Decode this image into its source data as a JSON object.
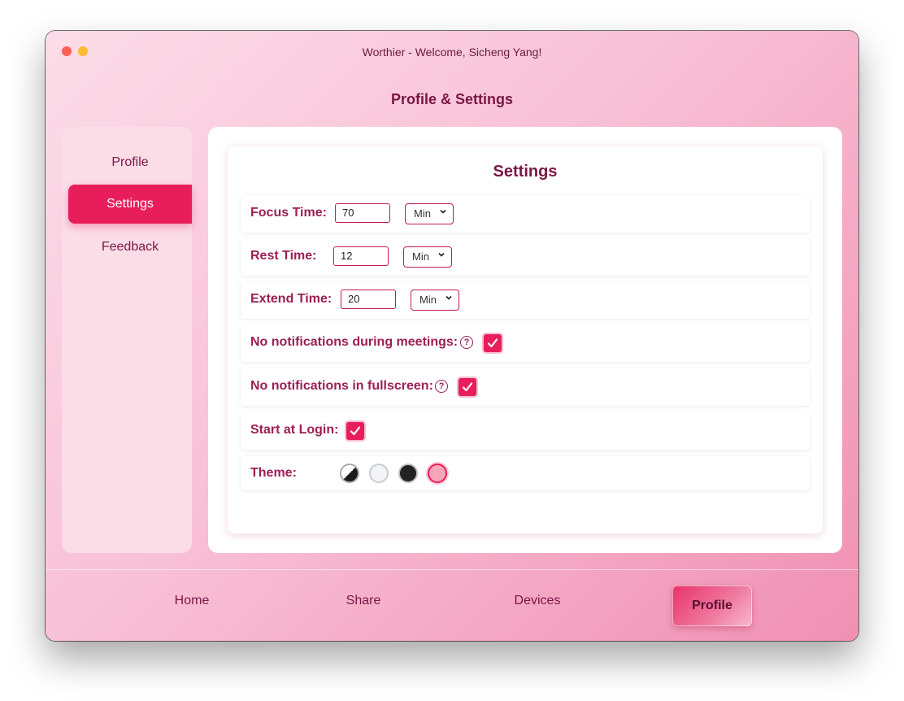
{
  "window": {
    "title": "Worthier - Welcome, Sicheng Yang!"
  },
  "page": {
    "title": "Profile & Settings"
  },
  "sidebar": {
    "items": [
      {
        "label": "Profile"
      },
      {
        "label": "Settings",
        "active": true
      },
      {
        "label": "Feedback"
      }
    ]
  },
  "settings": {
    "title": "Settings",
    "focus_time": {
      "label": "Focus Time:",
      "value": "70",
      "unit": "Min"
    },
    "rest_time": {
      "label": "Rest Time:",
      "value": "12",
      "unit": "Min"
    },
    "extend_time": {
      "label": "Extend Time:",
      "value": "20",
      "unit": "Min"
    },
    "no_notif_meetings": {
      "label": "No notifications during meetings:",
      "help": "?",
      "checked": true
    },
    "no_notif_fullscreen": {
      "label": "No notifications in fullscreen:",
      "help": "?",
      "checked": true
    },
    "start_at_login": {
      "label": "Start at Login:",
      "checked": true
    },
    "theme": {
      "label": "Theme:",
      "options": [
        "auto",
        "light",
        "dark",
        "pink"
      ],
      "selected": "pink"
    }
  },
  "bottom_nav": {
    "items": [
      {
        "label": "Home"
      },
      {
        "label": "Share"
      },
      {
        "label": "Devices"
      },
      {
        "label": "Profile",
        "active": true
      }
    ]
  },
  "colors": {
    "accent": "#e81e5c",
    "text": "#7a1645",
    "label": "#9b1f55"
  }
}
